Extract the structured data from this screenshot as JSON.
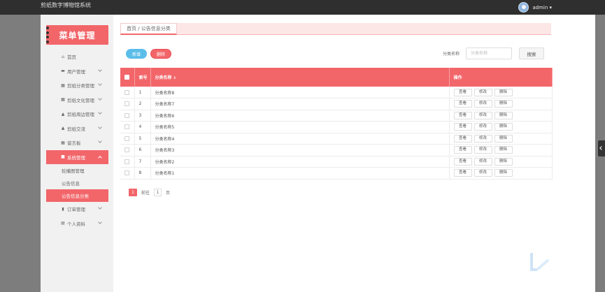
{
  "app": {
    "title": "剪纸数字博物馆系统",
    "user": "admin ▾"
  },
  "sidebar": {
    "banner": "菜单管理",
    "items": [
      {
        "label": "首页",
        "icon": "home-icon",
        "glyph": "⌂",
        "chevron": false
      },
      {
        "label": "用户管理",
        "icon": "user-group-icon",
        "glyph": "▬",
        "chevron": true
      },
      {
        "label": "剪纸分类管理",
        "icon": "grid-icon",
        "glyph": "▦",
        "chevron": true
      },
      {
        "label": "剪纸文化管理",
        "icon": "grid-icon",
        "glyph": "▦",
        "chevron": true
      },
      {
        "label": "剪纸周边管理",
        "icon": "person-icon",
        "glyph": "▲",
        "chevron": true
      },
      {
        "label": "剪纸交流",
        "icon": "person-icon",
        "glyph": "▲",
        "chevron": true
      },
      {
        "label": "留言板",
        "icon": "grid-icon",
        "glyph": "▦",
        "chevron": true
      },
      {
        "label": "系统管理",
        "icon": "settings-icon",
        "glyph": "■",
        "chevron": true,
        "active": true
      },
      {
        "label": "订单管理",
        "icon": "bar-chart-icon",
        "glyph": "▮",
        "chevron": true
      },
      {
        "label": "个人资料",
        "icon": "calendar-icon",
        "glyph": "▤",
        "chevron": true
      }
    ],
    "sub_items": [
      {
        "label": "轮播图管理"
      },
      {
        "label": "公告信息"
      },
      {
        "label": "公告信息分类",
        "active": true
      }
    ]
  },
  "breadcrumb": {
    "text": "首页 / 公告信息分类"
  },
  "toolbar": {
    "add_label": "新增",
    "delete_label": "删除",
    "search_label": "分类名称",
    "search_placeholder": "分类名称",
    "search_button": "搜索"
  },
  "table": {
    "headers": {
      "index": "索号",
      "name": "分类名称",
      "sort_icon": "⇕",
      "ops": "操作"
    },
    "rows": [
      {
        "index": "1",
        "name": "分类名称8"
      },
      {
        "index": "2",
        "name": "分类名称7"
      },
      {
        "index": "3",
        "name": "分类名称6"
      },
      {
        "index": "4",
        "name": "分类名称5"
      },
      {
        "index": "5",
        "name": "分类名称4"
      },
      {
        "index": "6",
        "name": "分类名称3"
      },
      {
        "index": "7",
        "name": "分类名称2"
      },
      {
        "index": "8",
        "name": "分类名称1"
      }
    ],
    "ops": {
      "view": "查看",
      "edit": "修改",
      "delete": "删除"
    }
  },
  "pagination": {
    "current": "1",
    "goto_label": "前往",
    "goto_value": "1",
    "page_suffix": "页"
  },
  "colors": {
    "accent": "#f2666a",
    "add_button": "#5bbde9",
    "topbar": "#2f2f2f",
    "sidebar": "#f1f1f1"
  }
}
